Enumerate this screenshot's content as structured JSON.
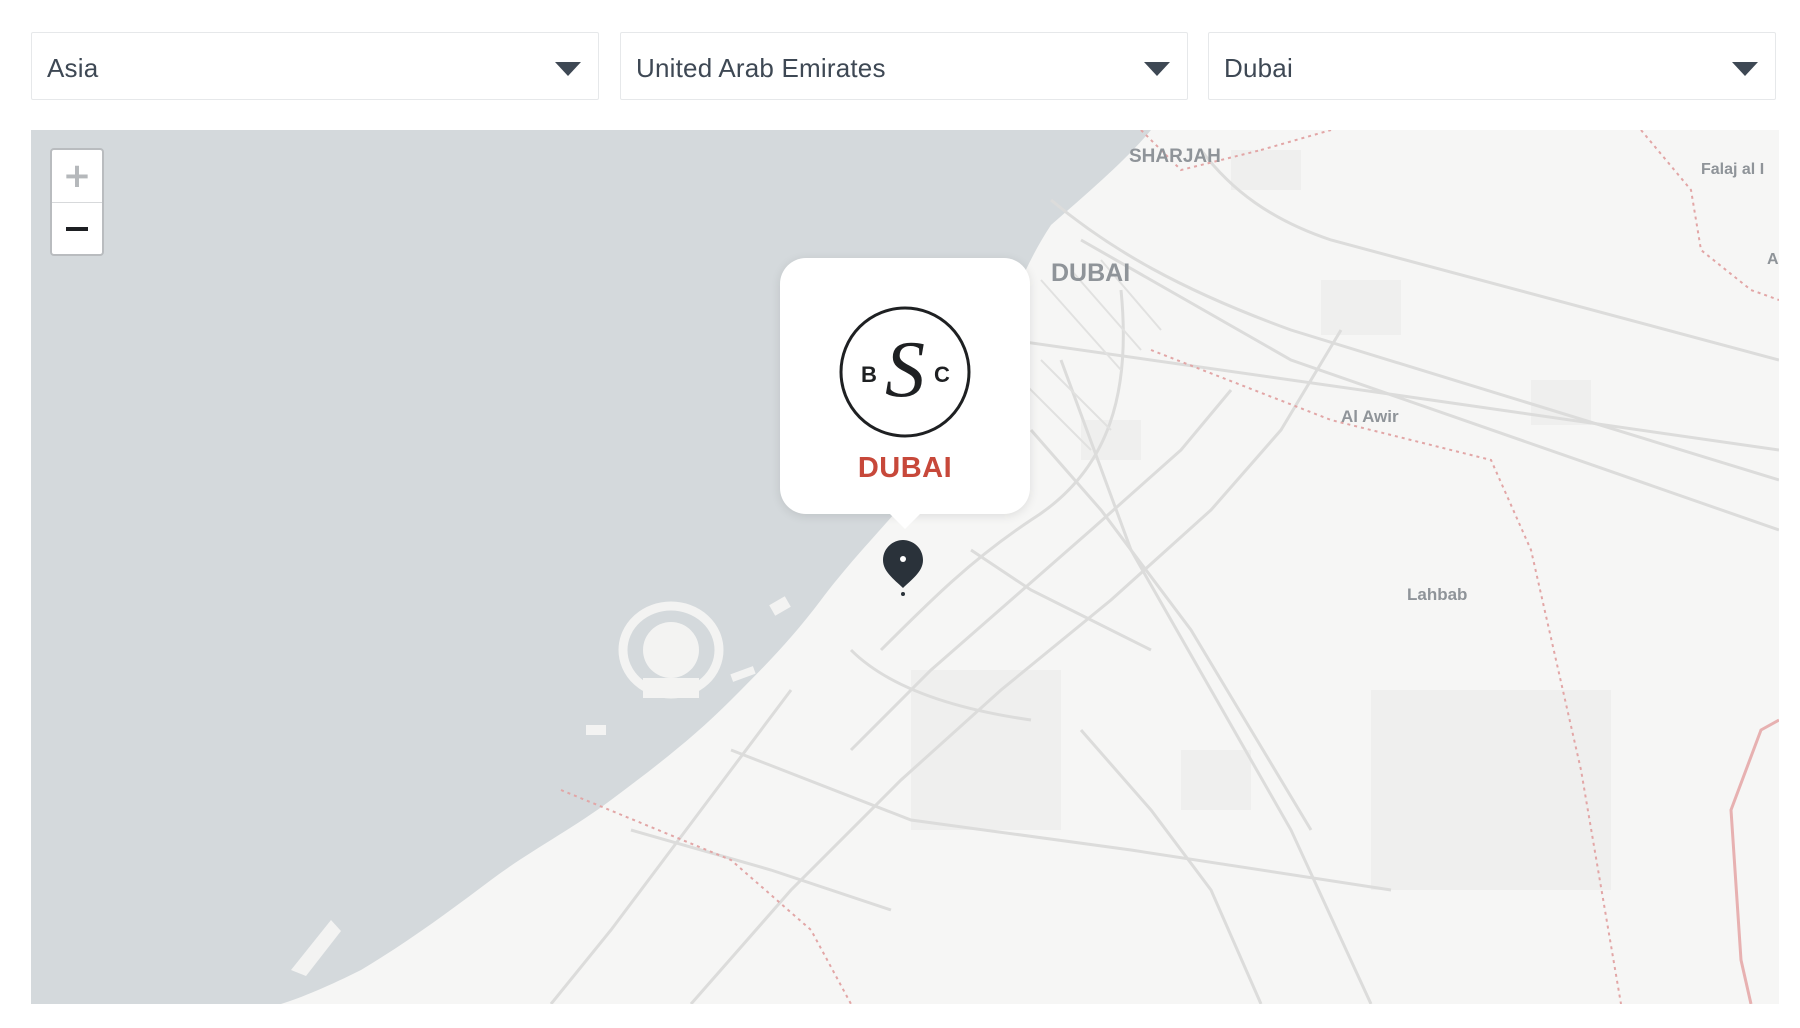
{
  "filters": {
    "region": {
      "value": "Asia"
    },
    "country": {
      "value": "United Arab Emirates"
    },
    "city": {
      "value": "Dubai"
    },
    "caret_icon": "chevron-down-icon"
  },
  "map": {
    "zoom_in_label": "+",
    "labels": {
      "sharjah": "SHARJAH",
      "dubai": "DUBAI",
      "falaj": "Falaj al I",
      "a_edge": "A",
      "al_awir": "Al Awir",
      "lahbab": "Lahbab"
    },
    "colors": {
      "sea": "#d4d9dc",
      "land": "#f6f6f5",
      "road": "#dcdcdb",
      "border": "#e2a6a6"
    }
  },
  "popup": {
    "logo_letters": {
      "left": "B",
      "center": "S",
      "right": "C"
    },
    "city": "DUBAI",
    "accent_color": "#c7483a"
  },
  "marker": {
    "icon": "map-pin-icon"
  }
}
